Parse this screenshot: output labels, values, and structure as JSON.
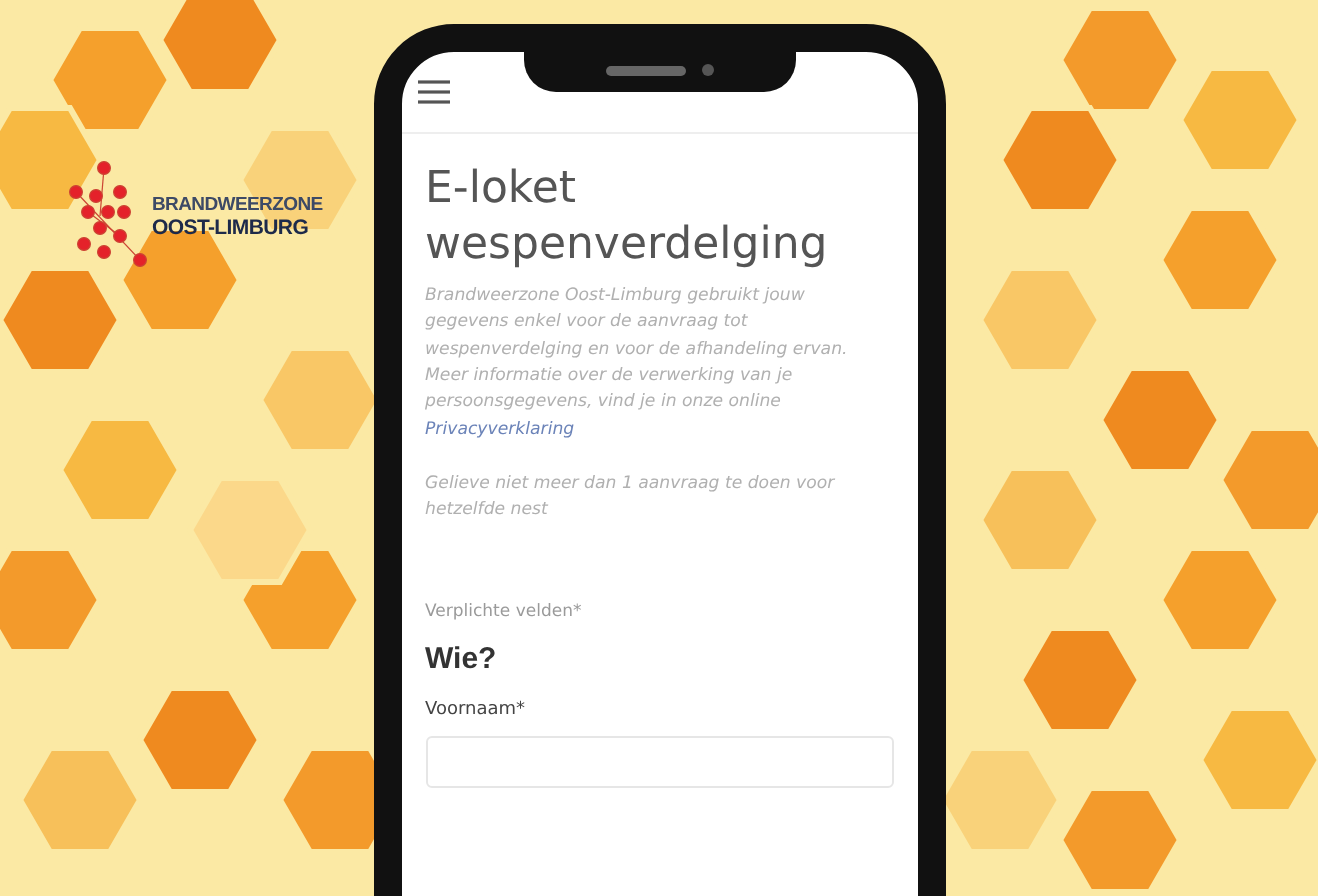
{
  "logo": {
    "line_1": "BRANDWEERZONE",
    "line_2": "OOST-LIMBURG"
  },
  "page": {
    "title": "E-loket wespenverdelging",
    "intro": "Brandweerzone Oost-Limburg gebruikt jouw gegevens enkel voor de aanvraag tot wespenverdelging en voor de afhandeling ervan. Meer informatie over de verwerking van je persoonsgegevens, vind je in onze online",
    "privacy_link": "Privacyverklaring",
    "notice": "Gelieve niet meer dan 1 aanvraag te doen voor hetzelfde nest",
    "required_note": "Verplichte velden*",
    "section_title": "Wie?",
    "fields": [
      {
        "label": "Voornaam*"
      }
    ]
  }
}
